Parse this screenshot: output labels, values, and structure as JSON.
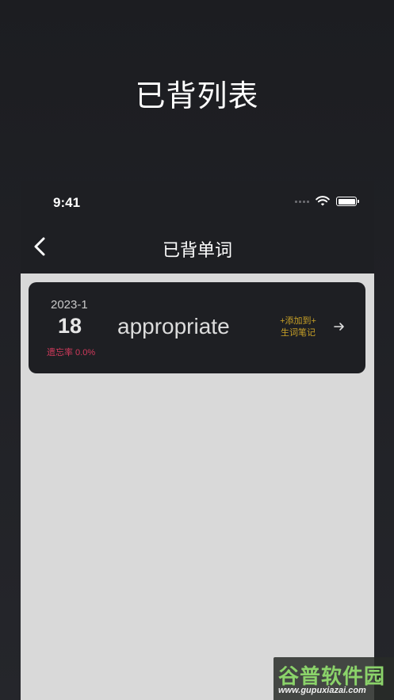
{
  "promo": {
    "title": "已背列表"
  },
  "status_bar": {
    "time": "9:41"
  },
  "nav": {
    "title": "已背单词",
    "back_icon": "chevron-left-icon"
  },
  "list": {
    "items": [
      {
        "date_month": "2023-1",
        "date_day": "18",
        "forget_rate": "遗忘率 0.0%",
        "word": "appropriate",
        "add_line1": "+添加到+",
        "add_line2": "生词笔记",
        "arrow_icon": "arrow-right-icon"
      }
    ]
  },
  "watermark": {
    "main": "谷普软件园",
    "url": "www.gupuxiazai.com"
  },
  "colors": {
    "forget_rate": "#d23a5c",
    "add_note": "#c9a227",
    "card_bg": "#1e1f23",
    "list_bg": "#d9d9d9"
  }
}
